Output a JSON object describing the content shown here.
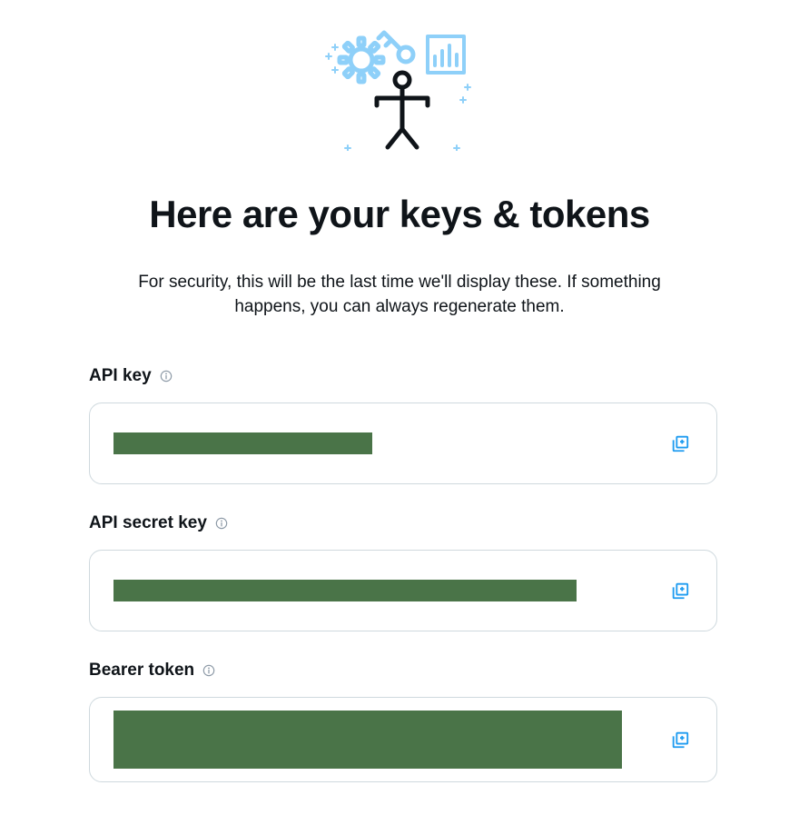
{
  "heading": "Here are your keys & tokens",
  "subtitle": "For security, this will be the last time we'll display these. If something happens, you can always regenerate them.",
  "fields": {
    "api_key": {
      "label": "API key",
      "value": "[redacted]"
    },
    "api_secret_key": {
      "label": "API secret key",
      "value": "[redacted]"
    },
    "bearer_token": {
      "label": "Bearer token",
      "value": "[redacted]"
    }
  },
  "colors": {
    "accent": "#1d9bf0",
    "redaction": "#4a7448",
    "border": "#cfd9de"
  }
}
